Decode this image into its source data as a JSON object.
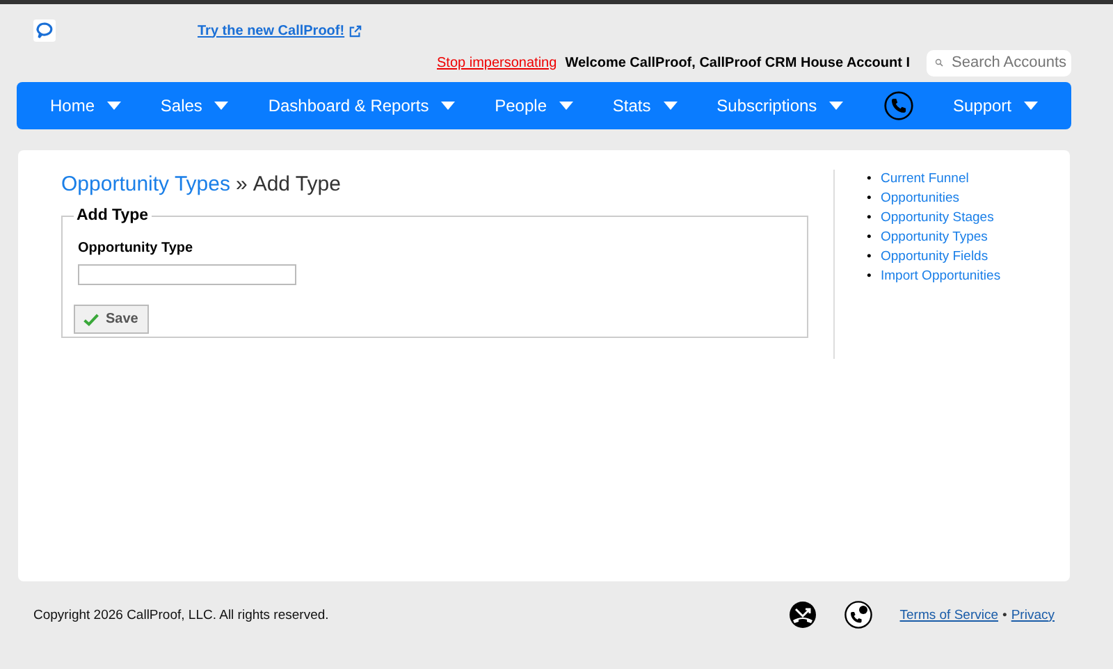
{
  "top": {
    "try_link": "Try the new CallProof!",
    "stop_link": "Stop impersonating",
    "welcome": "Welcome CallProof, CallProof CRM House Account I",
    "search": {
      "placeholder": "Search Accounts"
    }
  },
  "nav": [
    {
      "label": "Home",
      "kind": "menu"
    },
    {
      "label": "Sales",
      "kind": "menu"
    },
    {
      "label": "Dashboard & Reports",
      "kind": "menu"
    },
    {
      "label": "People",
      "kind": "menu"
    },
    {
      "label": "Stats",
      "kind": "menu"
    },
    {
      "label": "Subscriptions",
      "kind": "menu"
    },
    {
      "kind": "phone"
    },
    {
      "label": "Support",
      "kind": "menu"
    }
  ],
  "breadcrumb": {
    "link": "Opportunity Types",
    "sep": "»",
    "current": "Add Type"
  },
  "form": {
    "legend": "Add Type",
    "field_label": "Opportunity Type",
    "save": "Save"
  },
  "sidebar": {
    "bullet": "•",
    "items": [
      "Current Funnel",
      "Opportunities",
      "Opportunity Stages",
      "Opportunity Types",
      "Opportunity Fields",
      "Import Opportunities"
    ]
  },
  "footer": {
    "copyright": "Copyright 2026 CallProof, LLC. All rights reserved.",
    "links": [
      "Terms of Service",
      "Privacy"
    ],
    "sep": "•"
  }
}
